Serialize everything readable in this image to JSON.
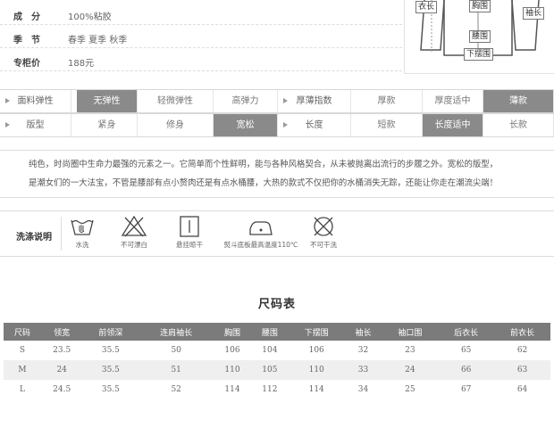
{
  "product_info": [
    {
      "label": "成　分",
      "value": "100%粘胶"
    },
    {
      "label": "季　节",
      "value": "春季 夏季 秋季"
    },
    {
      "label": "专柜价",
      "value": "188元"
    }
  ],
  "diagram": {
    "tags": [
      "衣长",
      "胸围",
      "袖长",
      "腰围",
      "下摆围"
    ]
  },
  "attributes": {
    "row1": [
      "面料弹性",
      "无弹性",
      "轻微弹性",
      "高弹力",
      "厚薄指数",
      "厚款",
      "厚度适中",
      "薄款"
    ],
    "row1_selected": [
      1,
      7
    ],
    "row2": [
      "版型",
      "紧身",
      "修身",
      "宽松",
      "长度",
      "短款",
      "长度适中",
      "长款"
    ],
    "row2_selected": [
      3,
      6
    ]
  },
  "description": {
    "line1": "纯色，时尚圈中生命力最强的元素之一。它简单而个性鲜明，能与各种风格契合，从未被抛离出流行的步履之外。宽松的版型，",
    "line2": "是潮女们的一大法宝，不管是腰部有点小赘肉还是有点水桶腰，大热的款式不仅把你的水桶消失无踪，还能让你走在潮流尖端！"
  },
  "washing": {
    "title": "洗涤说明",
    "items": [
      {
        "icon": "hand-wash-icon",
        "label": "水洗"
      },
      {
        "icon": "no-bleach-icon",
        "label": "不可漂白"
      },
      {
        "icon": "hang-dry-icon",
        "label": "悬挂晾干"
      },
      {
        "icon": "iron-icon",
        "label": "熨斗底板最高温度110℃"
      },
      {
        "icon": "no-dry-clean-icon",
        "label": "不可干洗"
      }
    ]
  },
  "size_chart": {
    "title": "尺码表",
    "headers": [
      "尺码",
      "领宽",
      "前领深",
      "连肩袖长",
      "胸围",
      "腰围",
      "下摆围",
      "袖长",
      "袖口围",
      "后衣长",
      "前衣长"
    ],
    "rows": [
      [
        "S",
        "23.5",
        "35.5",
        "50",
        "106",
        "104",
        "106",
        "32",
        "23",
        "65",
        "62"
      ],
      [
        "M",
        "24",
        "35.5",
        "51",
        "110",
        "105",
        "110",
        "33",
        "24",
        "66",
        "63"
      ],
      [
        "L",
        "24.5",
        "35.5",
        "52",
        "114",
        "112",
        "114",
        "34",
        "25",
        "67",
        "64"
      ]
    ]
  }
}
